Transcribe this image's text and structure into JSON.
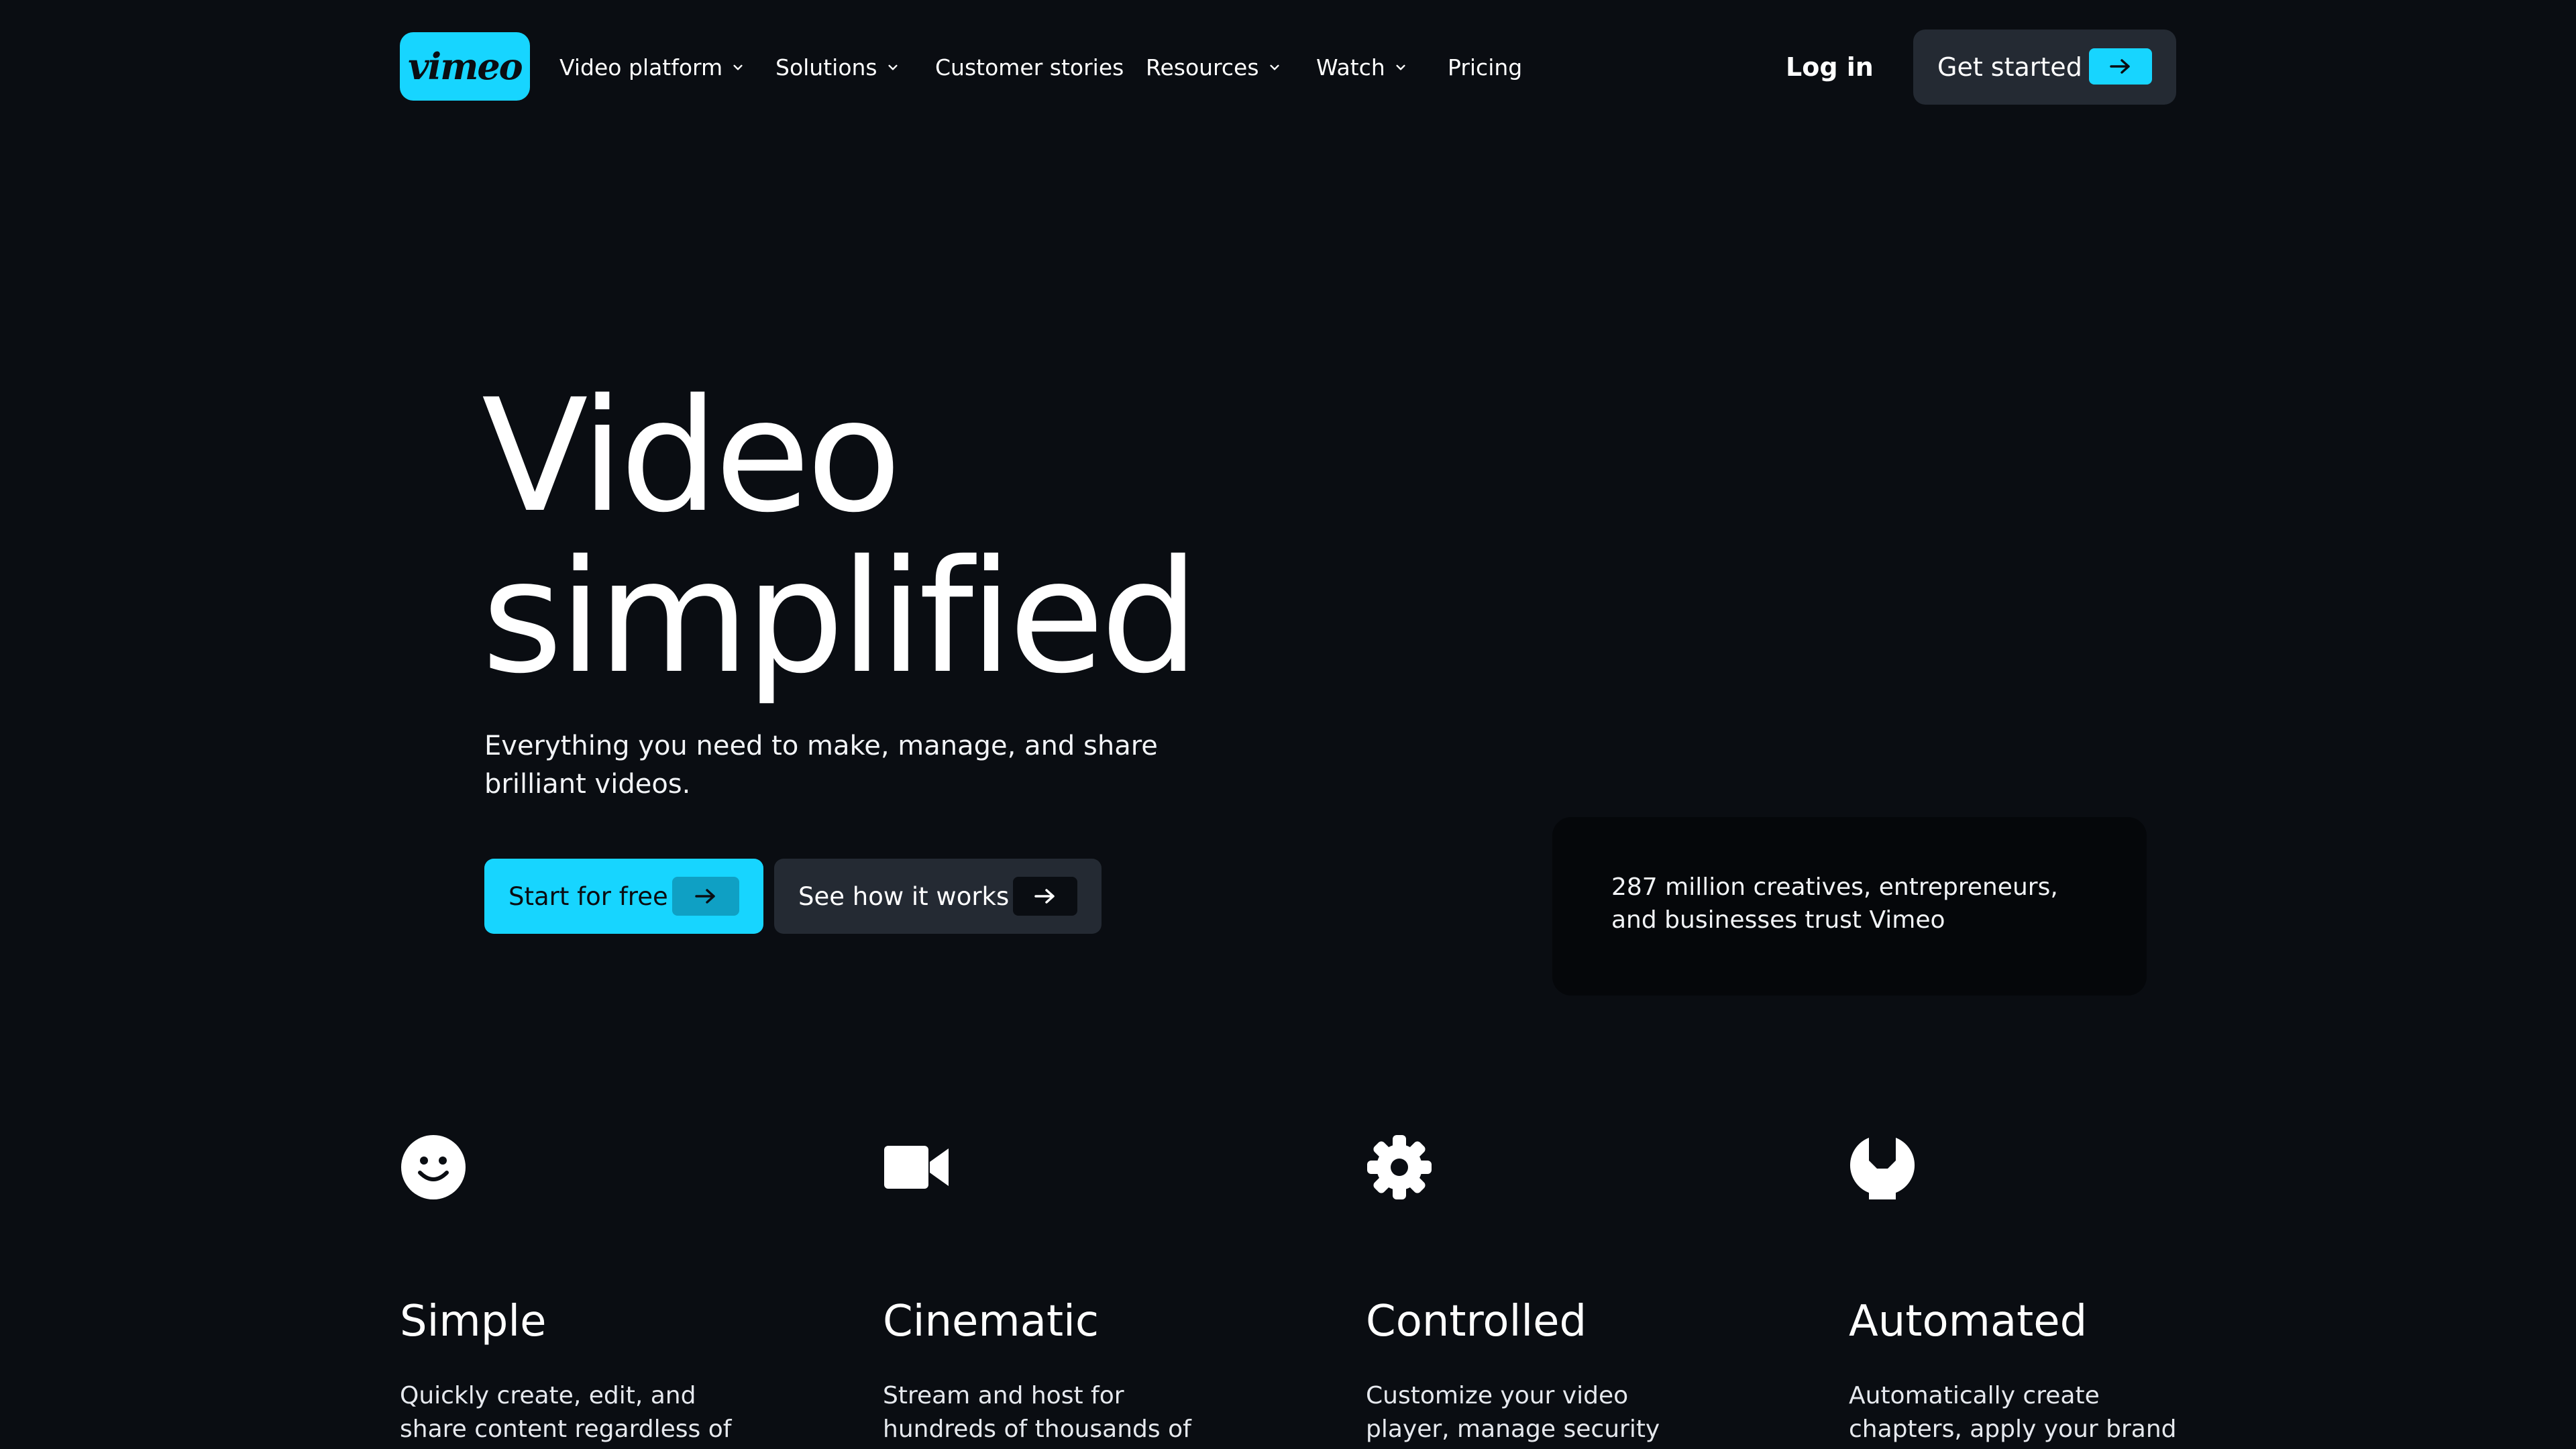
{
  "nav": {
    "logo_text": "vimeo",
    "items": [
      {
        "label": "Video platform",
        "has_dropdown": true
      },
      {
        "label": "Solutions",
        "has_dropdown": true
      },
      {
        "label": "Customer stories",
        "has_dropdown": false
      },
      {
        "label": "Resources",
        "has_dropdown": true
      },
      {
        "label": "Watch",
        "has_dropdown": true
      },
      {
        "label": "Pricing",
        "has_dropdown": false
      }
    ],
    "login_label": "Log in",
    "get_started_label": "Get started"
  },
  "hero": {
    "title_line1": "Video",
    "title_line2": "simplified",
    "subtitle": "Everything you need to make, manage, and share brilliant videos.",
    "primary_cta": "Start for free",
    "secondary_cta": "See how it works",
    "trust_text": "287 million creatives, entrepreneurs, and businesses trust Vimeo"
  },
  "features": [
    {
      "icon": "smiley-icon",
      "title": "Simple",
      "description": "Quickly create, edit, and share content regardless of"
    },
    {
      "icon": "video-camera-icon",
      "title": "Cinematic",
      "description": "Stream and host for hundreds of thousands of"
    },
    {
      "icon": "gear-icon",
      "title": "Controlled",
      "description": "Customize your video player, manage security"
    },
    {
      "icon": "wrench-icon",
      "title": "Automated",
      "description": "Automatically create chapters, apply your brand"
    }
  ],
  "colors": {
    "background": "#0a0d12",
    "accent": "#17d5ff",
    "button_dark": "#242a33",
    "card": "#05070a"
  }
}
